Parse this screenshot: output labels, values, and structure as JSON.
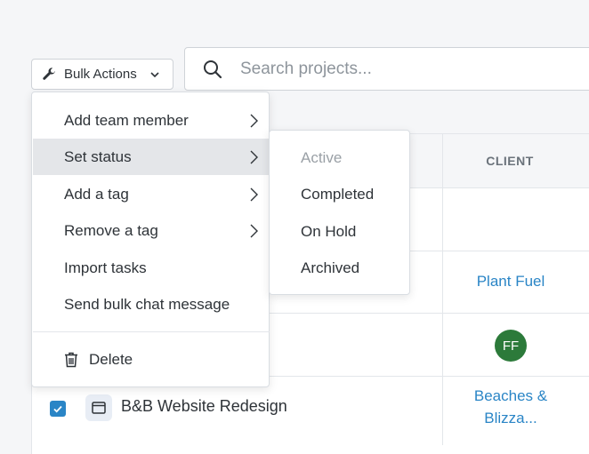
{
  "toolbar": {
    "bulk_actions_label": "Bulk Actions",
    "search_placeholder": "Search projects..."
  },
  "table": {
    "columns": [
      "CLIENT"
    ],
    "rows": [
      {
        "client": ""
      },
      {
        "client": "Plant Fuel"
      },
      {
        "client_avatar": "FF"
      },
      {
        "checked": true,
        "project": "B&B Website Redesign",
        "client_line1": "Beaches &",
        "client_line2": "Blizza..."
      }
    ]
  },
  "menu": {
    "items": [
      {
        "label": "Add team member",
        "has_submenu": true
      },
      {
        "label": "Set status",
        "has_submenu": true,
        "highlighted": true
      },
      {
        "label": "Add a tag",
        "has_submenu": true
      },
      {
        "label": "Remove a tag",
        "has_submenu": true
      },
      {
        "label": "Import tasks",
        "has_submenu": false
      },
      {
        "label": "Send bulk chat message",
        "has_submenu": false
      }
    ],
    "delete_label": "Delete"
  },
  "status_submenu": {
    "items": [
      {
        "label": "Active",
        "disabled": true
      },
      {
        "label": "Completed",
        "disabled": false
      },
      {
        "label": "On Hold",
        "disabled": false
      },
      {
        "label": "Archived",
        "disabled": false
      }
    ]
  },
  "colors": {
    "link": "#2a85c6",
    "avatar_bg": "#2c7a3a",
    "checkbox": "#2a85c6",
    "menu_highlight": "#e4e6e9"
  },
  "icons": [
    "wrench-icon",
    "chevron-down-icon",
    "search-icon",
    "chevron-right-icon",
    "trash-icon",
    "browser-window-icon",
    "checkmark-icon"
  ]
}
